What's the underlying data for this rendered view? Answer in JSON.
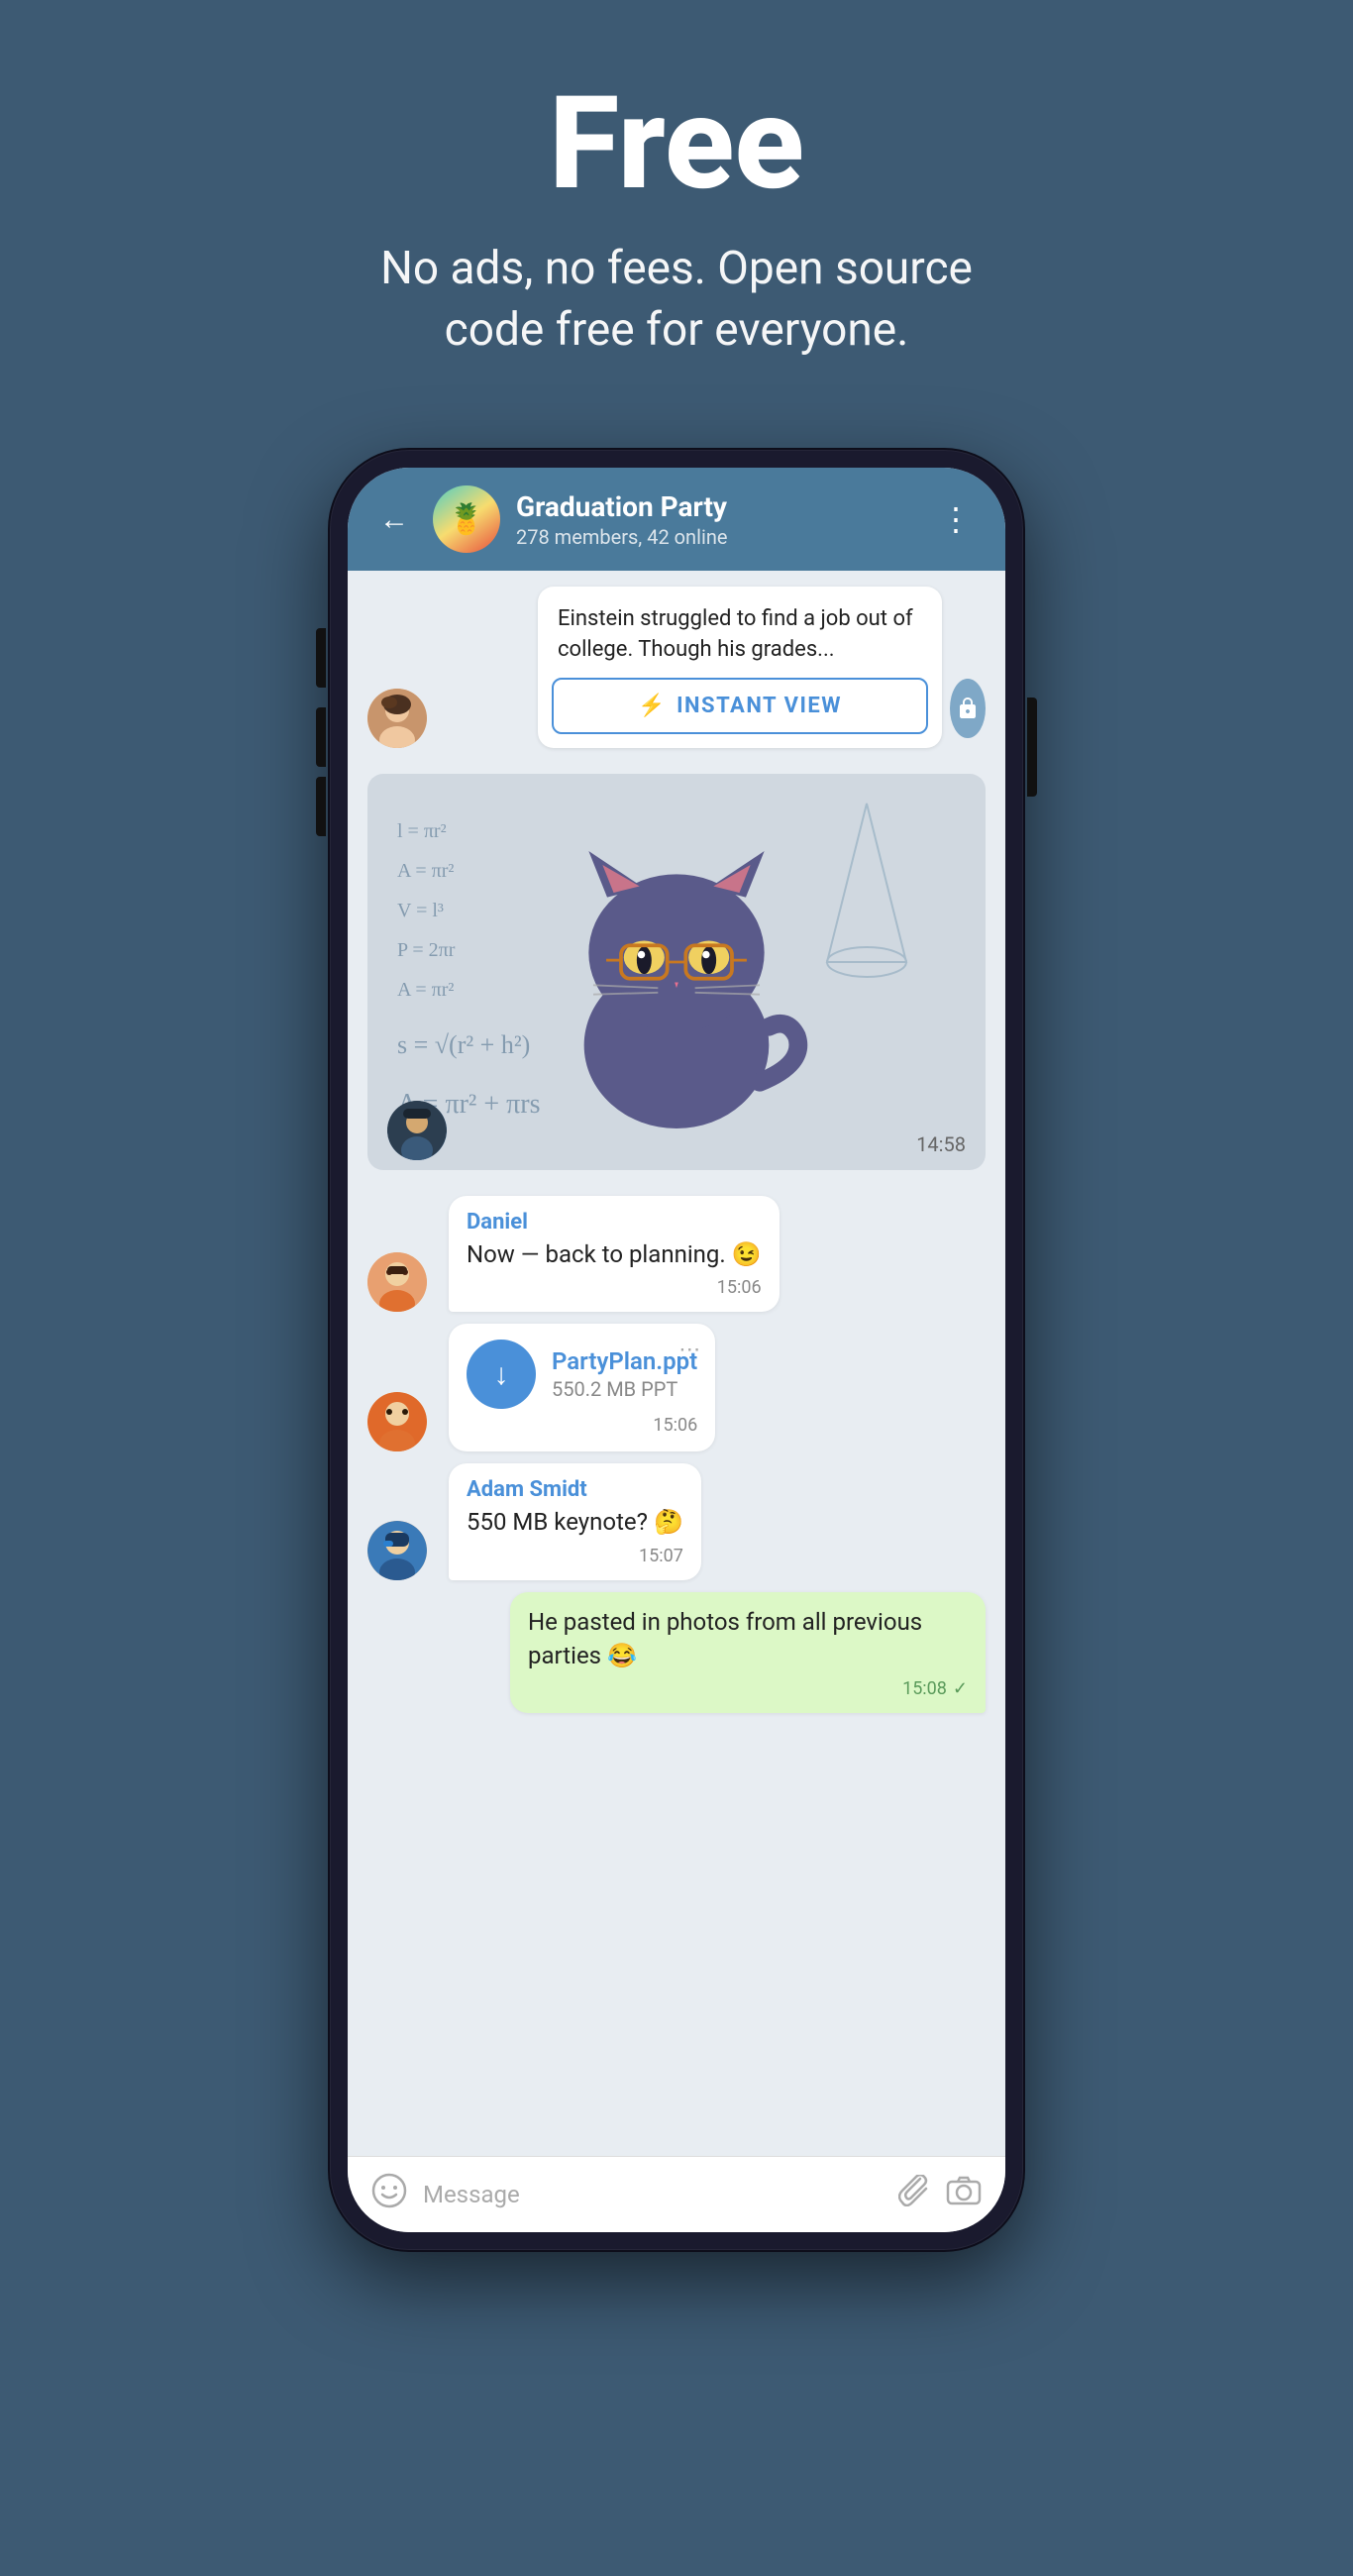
{
  "hero": {
    "title": "Free",
    "subtitle": "No ads, no fees. Open source\ncode free for everyone."
  },
  "header": {
    "back_label": "←",
    "group_name": "Graduation Party",
    "group_members": "278 members, 42 online",
    "menu_label": "⋮",
    "group_emoji": "🍍"
  },
  "article": {
    "text": "Einstein struggled to find a job out of college. Though his grades...",
    "instant_view_label": "INSTANT VIEW"
  },
  "sticker": {
    "time": "14:58"
  },
  "messages": [
    {
      "sender": "Daniel",
      "text": "Now — back to planning. 😉",
      "time": "15:06",
      "outgoing": false
    },
    {
      "type": "file",
      "file_name": "PartyPlan.ppt",
      "file_size": "550.2 MB PPT",
      "time": "15:06",
      "outgoing": false
    },
    {
      "sender": "Adam Smidt",
      "text": "550 MB keynote? 🤔",
      "time": "15:07",
      "outgoing": false
    },
    {
      "text": "He pasted in photos from all previous parties 😂",
      "time": "15:08",
      "outgoing": true
    }
  ],
  "input": {
    "placeholder": "Message"
  }
}
